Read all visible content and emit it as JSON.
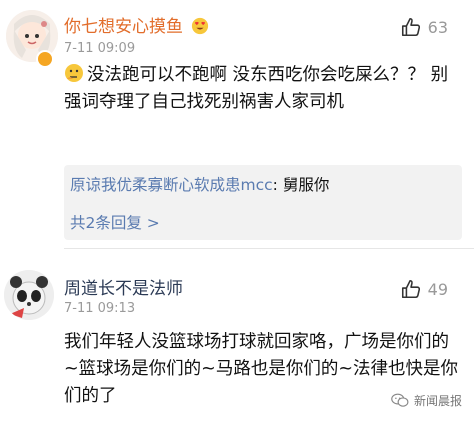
{
  "comments": [
    {
      "username": "你七想安心摸鱼",
      "time": "7-11 09:09",
      "likes": "63",
      "text": "没法跑可以不跑啊 没东西吃你会吃屎么？？ 别强词夺理了自己找死别祸害人家司机",
      "reply": {
        "user": "原谅我优柔寡断心软成患mcc",
        "text": "舅服你",
        "more": "共2条回复 >"
      }
    },
    {
      "username": "周道长不是法师",
      "time": "7-11 09:13",
      "likes": "49",
      "text": "我们年轻人没篮球场打球就回家咯，广场是你们的~篮球场是你们的~马路也是你们的~法律也快是你们的了"
    }
  ],
  "watermark": "新闻晨报",
  "icons": {
    "like": "thumbs-up-icon",
    "emoji": "thinking-face-icon",
    "name_emoji": "heart-eyes-icon",
    "badge": "vip-badge-icon",
    "wechat": "wechat-icon"
  },
  "colors": {
    "name_highlight": "#e26d2b",
    "link": "#5a7bb0",
    "muted": "#9a9a9a"
  }
}
